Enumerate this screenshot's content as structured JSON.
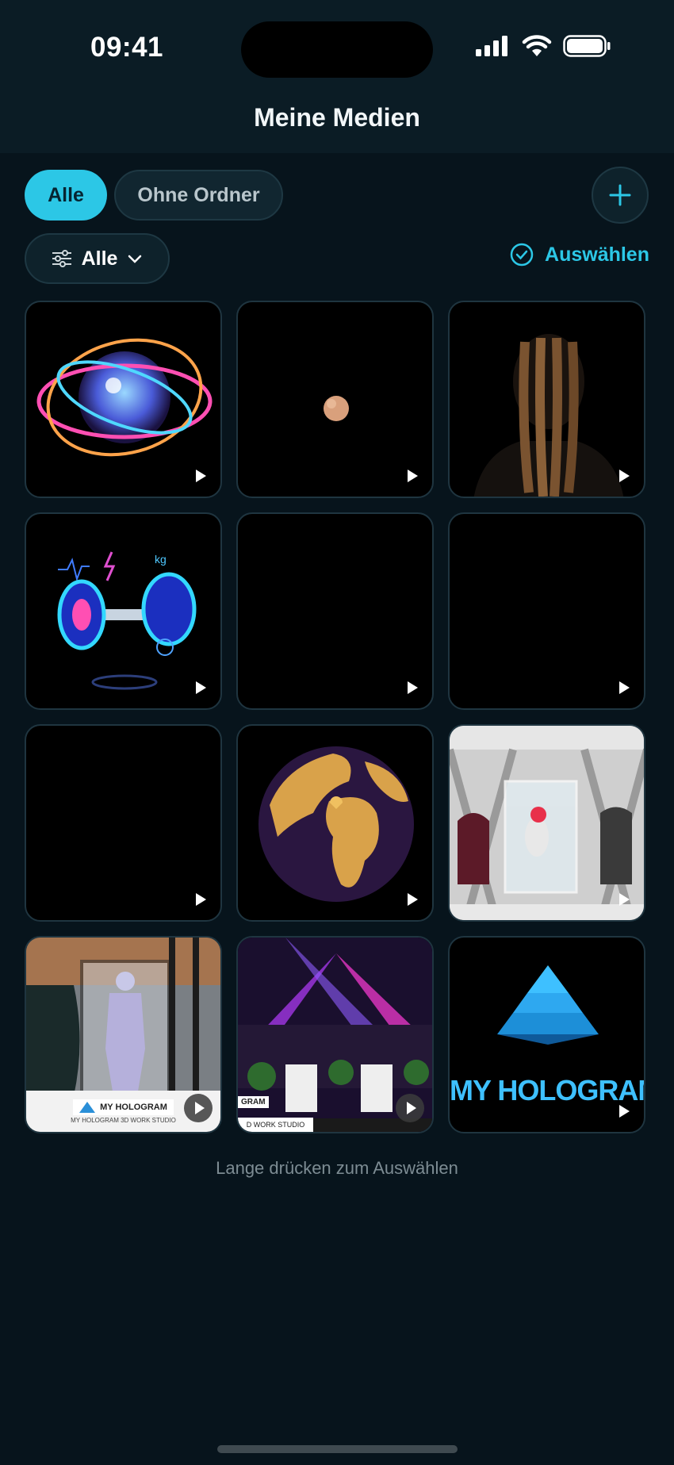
{
  "status": {
    "time": "09:41"
  },
  "header": {
    "title": "Meine Medien"
  },
  "chips": {
    "all": "Alle",
    "no_folder": "Ohne Ordner"
  },
  "filter": {
    "label": "Alle"
  },
  "select": {
    "label": "Auswählen"
  },
  "tiles": [
    {
      "kind": "disco-ball-icon",
      "label": ""
    },
    {
      "kind": "small-object",
      "label": ""
    },
    {
      "kind": "braids",
      "label": ""
    },
    {
      "kind": "dumbbell",
      "label": "kg"
    },
    {
      "kind": "black",
      "label": ""
    },
    {
      "kind": "black",
      "label": ""
    },
    {
      "kind": "black",
      "label": ""
    },
    {
      "kind": "globe",
      "label": ""
    },
    {
      "kind": "store-photo",
      "label": ""
    },
    {
      "kind": "hologram-person",
      "label": "MY HOLOGRAM",
      "caption": "MY HOLOGRAM 3D WORK STUDIO"
    },
    {
      "kind": "stage",
      "label": "GRAM",
      "caption": "D WORK STUDIO"
    },
    {
      "kind": "pyramid-logo",
      "label": "MY HOLOGRAM"
    }
  ],
  "hint": "Lange drücken zum Auswählen",
  "colors": {
    "accent": "#2cc7e6",
    "background": "#07141c",
    "header": "#0b1c25"
  }
}
